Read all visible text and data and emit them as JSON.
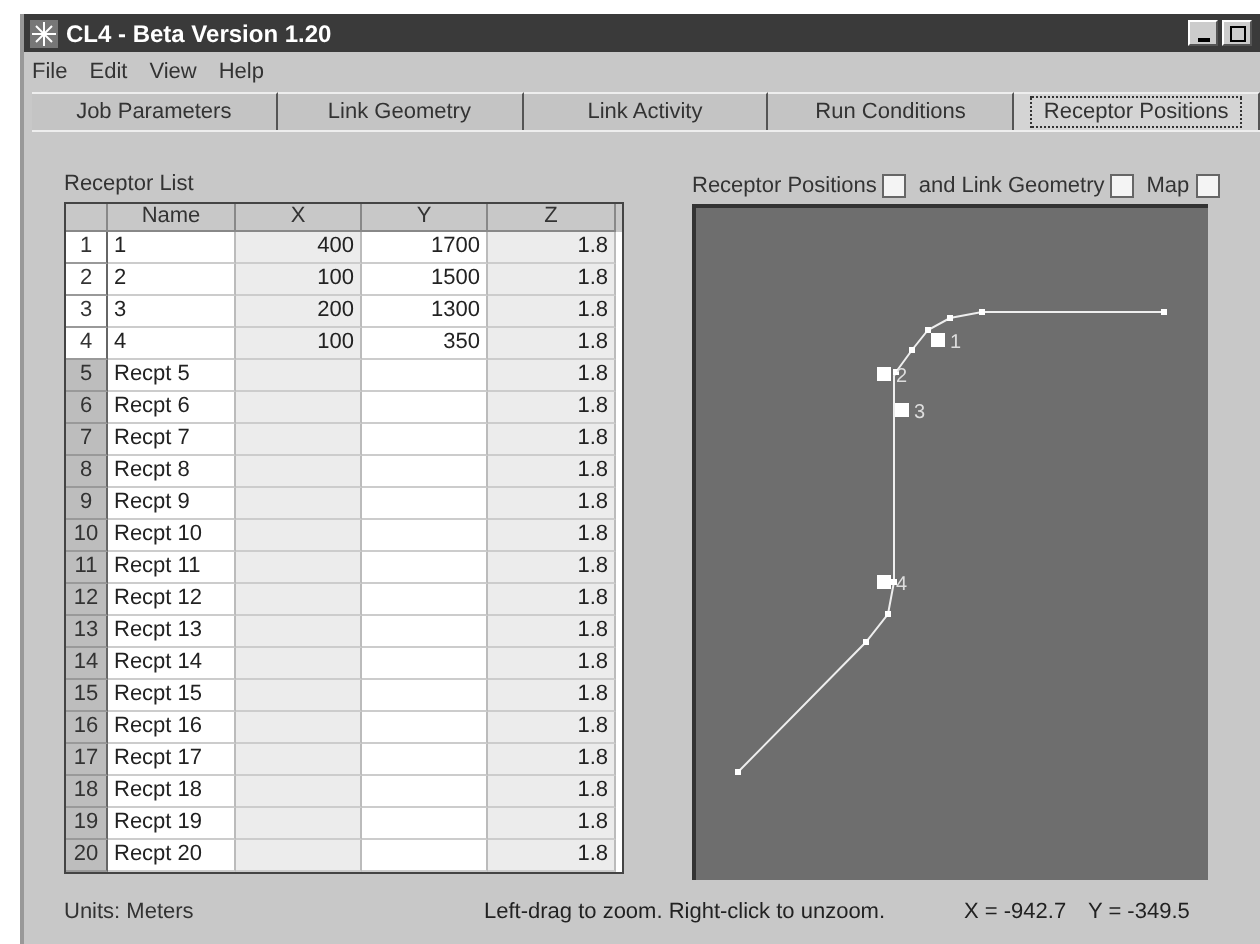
{
  "window": {
    "title": "CL4 - Beta Version 1.20"
  },
  "menu": [
    "File",
    "Edit",
    "View",
    "Help"
  ],
  "tabs": [
    {
      "label": "Job Parameters",
      "selected": false
    },
    {
      "label": "Link Geometry",
      "selected": false
    },
    {
      "label": "Link Activity",
      "selected": false
    },
    {
      "label": "Run Conditions",
      "selected": false
    },
    {
      "label": "Receptor Positions",
      "selected": true
    }
  ],
  "receptor_list": {
    "title": "Receptor List",
    "columns": [
      "Name",
      "X",
      "Y",
      "Z"
    ],
    "rows": [
      {
        "num": "1",
        "defined": true,
        "cells": [
          "1",
          "400",
          "1700",
          "1.8"
        ]
      },
      {
        "num": "2",
        "defined": true,
        "cells": [
          "2",
          "100",
          "1500",
          "1.8"
        ]
      },
      {
        "num": "3",
        "defined": true,
        "cells": [
          "3",
          "200",
          "1300",
          "1.8"
        ]
      },
      {
        "num": "4",
        "defined": true,
        "cells": [
          "4",
          "100",
          "350",
          "1.8"
        ]
      },
      {
        "num": "5",
        "defined": false,
        "cells": [
          "Recpt 5",
          "",
          "",
          "1.8"
        ]
      },
      {
        "num": "6",
        "defined": false,
        "cells": [
          "Recpt 6",
          "",
          "",
          "1.8"
        ]
      },
      {
        "num": "7",
        "defined": false,
        "cells": [
          "Recpt 7",
          "",
          "",
          "1.8"
        ]
      },
      {
        "num": "8",
        "defined": false,
        "cells": [
          "Recpt 8",
          "",
          "",
          "1.8"
        ]
      },
      {
        "num": "9",
        "defined": false,
        "cells": [
          "Recpt 9",
          "",
          "",
          "1.8"
        ]
      },
      {
        "num": "10",
        "defined": false,
        "cells": [
          "Recpt 10",
          "",
          "",
          "1.8"
        ]
      },
      {
        "num": "11",
        "defined": false,
        "cells": [
          "Recpt 11",
          "",
          "",
          "1.8"
        ]
      },
      {
        "num": "12",
        "defined": false,
        "cells": [
          "Recpt 12",
          "",
          "",
          "1.8"
        ]
      },
      {
        "num": "13",
        "defined": false,
        "cells": [
          "Recpt 13",
          "",
          "",
          "1.8"
        ]
      },
      {
        "num": "14",
        "defined": false,
        "cells": [
          "Recpt 14",
          "",
          "",
          "1.8"
        ]
      },
      {
        "num": "15",
        "defined": false,
        "cells": [
          "Recpt 15",
          "",
          "",
          "1.8"
        ]
      },
      {
        "num": "16",
        "defined": false,
        "cells": [
          "Recpt 16",
          "",
          "",
          "1.8"
        ]
      },
      {
        "num": "17",
        "defined": false,
        "cells": [
          "Recpt 17",
          "",
          "",
          "1.8"
        ]
      },
      {
        "num": "18",
        "defined": false,
        "cells": [
          "Recpt 18",
          "",
          "",
          "1.8"
        ]
      },
      {
        "num": "19",
        "defined": false,
        "cells": [
          "Recpt 19",
          "",
          "",
          "1.8"
        ]
      },
      {
        "num": "20",
        "defined": false,
        "cells": [
          "Recpt 20",
          "",
          "",
          "1.8"
        ]
      }
    ]
  },
  "map": {
    "options": [
      {
        "label": "Receptor Positions",
        "checked": false
      },
      {
        "label": "and Link Geometry",
        "checked": false
      },
      {
        "label": "Map",
        "checked": false
      }
    ],
    "receptor_labels": [
      "1",
      "2",
      "3",
      "4"
    ]
  },
  "status_bar": {
    "units": "Units:  Meters",
    "hint": "Left-drag to zoom.  Right-click to unzoom.",
    "x": "X = -942.7",
    "y": "Y = -349.5"
  }
}
